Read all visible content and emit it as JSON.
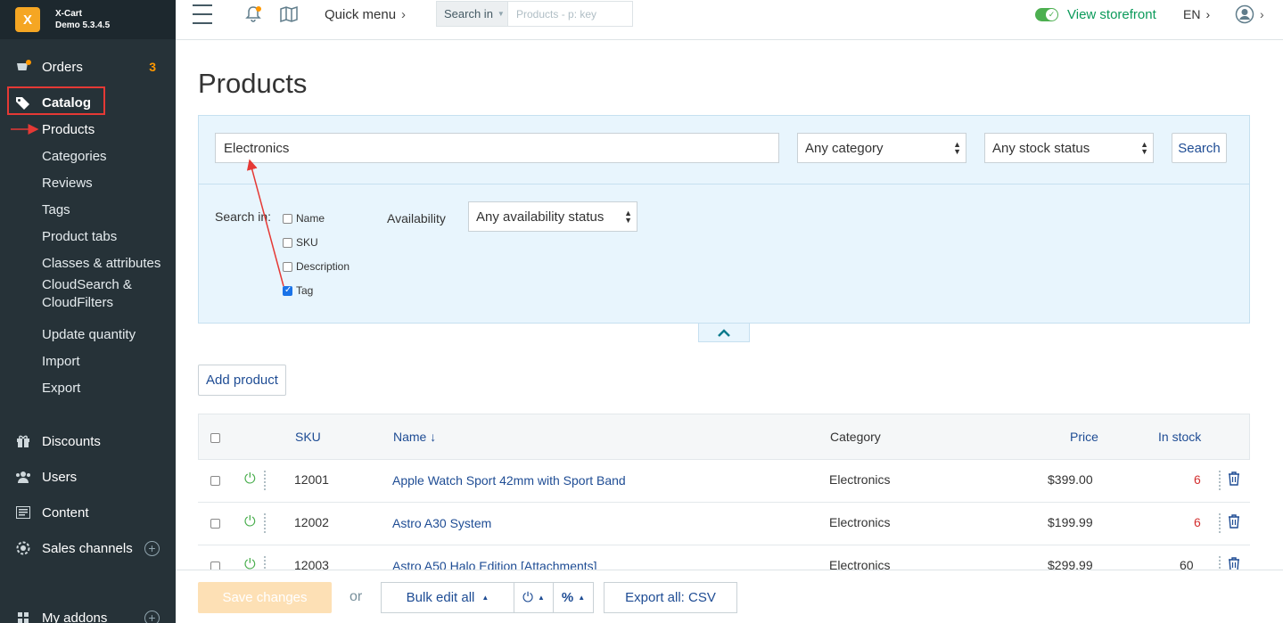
{
  "brand": {
    "logo_glyph": "X",
    "name": "X-Cart",
    "version": "Demo 5.3.4.5"
  },
  "sidebar": {
    "orders": {
      "label": "Orders",
      "count": "3"
    },
    "catalog": {
      "label": "Catalog"
    },
    "catalog_items": [
      "Products",
      "Categories",
      "Reviews",
      "Tags",
      "Product tabs",
      "Classes & attributes",
      "CloudSearch &",
      "CloudFilters",
      "Update quantity",
      "Import",
      "Export"
    ],
    "discounts": "Discounts",
    "users": "Users",
    "content": "Content",
    "sales_channels": "Sales channels",
    "my_addons": "My addons"
  },
  "topbar": {
    "quick_menu": "Quick menu",
    "search_in_label": "Search in",
    "search_placeholder": "Products - p: key",
    "view_storefront": "View storefront",
    "language": "EN"
  },
  "page": {
    "title": "Products"
  },
  "filters": {
    "keyword_value": "Electronics",
    "category_select": "Any category",
    "stock_select": "Any stock status",
    "search_button": "Search",
    "search_in_label": "Search in:",
    "search_in_options": [
      {
        "label": "Name",
        "checked": false
      },
      {
        "label": "SKU",
        "checked": false
      },
      {
        "label": "Description",
        "checked": false
      },
      {
        "label": "Tag",
        "checked": true
      }
    ],
    "availability_label": "Availability",
    "availability_select": "Any availability status"
  },
  "add_product_button": "Add product",
  "table": {
    "headers": {
      "sku": "SKU",
      "name": "Name ↓",
      "category": "Category",
      "price": "Price",
      "stock": "In stock"
    },
    "rows": [
      {
        "sku": "12001",
        "name": "Apple Watch Sport 42mm with Sport Band",
        "category": "Electronics",
        "price": "$399.00",
        "stock": "6"
      },
      {
        "sku": "12002",
        "name": "Astro A30 System",
        "category": "Electronics",
        "price": "$199.99",
        "stock": "6"
      },
      {
        "sku": "12003",
        "name": "Astro A50 Halo Edition [Attachments]",
        "category": "Electronics",
        "price": "$299.99",
        "stock": "60"
      }
    ]
  },
  "bottombar": {
    "save_changes": "Save changes",
    "or": "or",
    "bulk_edit": "Bulk edit all",
    "export": "Export all: CSV"
  },
  "colors": {
    "sidebar_bg": "#263238",
    "accent": "#ff9800",
    "link": "#1e4c94",
    "success": "#4caf50",
    "annotation": "#e53935"
  }
}
